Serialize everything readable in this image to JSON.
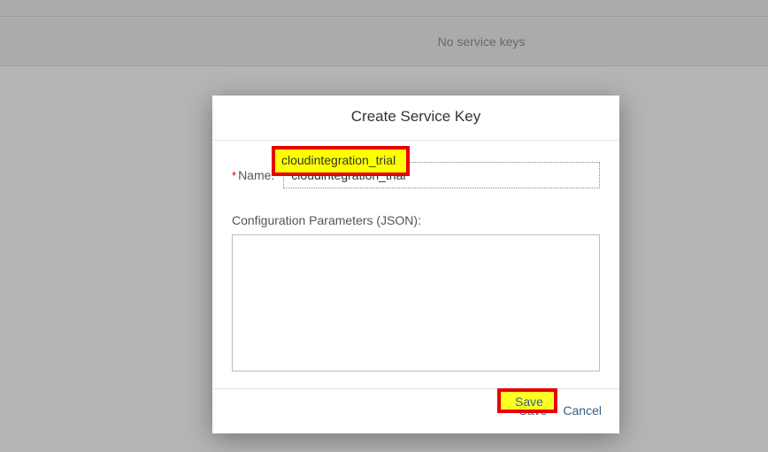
{
  "background": {
    "no_keys_text": "No service keys"
  },
  "dialog": {
    "title": "Create Service Key",
    "name_field": {
      "required_marker": "*",
      "label": "Name:",
      "value": "cloudintegration_trial"
    },
    "config_label": "Configuration Parameters (JSON):",
    "config_value": "",
    "buttons": {
      "save": "Save",
      "cancel": "Cancel"
    }
  }
}
